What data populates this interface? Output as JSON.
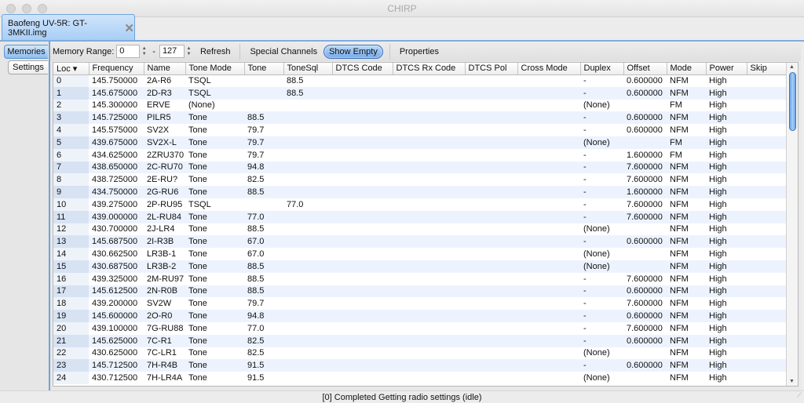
{
  "window": {
    "title": "CHIRP"
  },
  "doc_tab": {
    "label": "Baofeng UV-5R: GT-3MKII.img",
    "close_icon": "close-x-icon"
  },
  "side_tabs": [
    {
      "label": "Memories",
      "active": true
    },
    {
      "label": "Settings",
      "active": false
    }
  ],
  "toolbar": {
    "memory_range_label": "Memory Range:",
    "range_start": "0",
    "range_dash": "-",
    "range_end": "127",
    "refresh": "Refresh",
    "special_channels": "Special Channels",
    "show_empty": "Show Empty",
    "properties": "Properties"
  },
  "table": {
    "columns": [
      "Loc ▾",
      "Frequency",
      "Name",
      "Tone Mode",
      "Tone",
      "ToneSql",
      "DTCS Code",
      "DTCS Rx Code",
      "DTCS Pol",
      "Cross Mode",
      "Duplex",
      "Offset",
      "Mode",
      "Power",
      "Skip"
    ],
    "rows": [
      [
        "0",
        "145.750000",
        "2A-R6",
        "TSQL",
        "",
        "88.5",
        "",
        "",
        "",
        "",
        "-",
        "0.600000",
        "NFM",
        "High",
        ""
      ],
      [
        "1",
        "145.675000",
        "2D-R3",
        "TSQL",
        "",
        "88.5",
        "",
        "",
        "",
        "",
        "-",
        "0.600000",
        "NFM",
        "High",
        ""
      ],
      [
        "2",
        "145.300000",
        "ERVE",
        "(None)",
        "",
        "",
        "",
        "",
        "",
        "",
        "(None)",
        "",
        "FM",
        "High",
        ""
      ],
      [
        "3",
        "145.725000",
        "PILR5",
        "Tone",
        "88.5",
        "",
        "",
        "",
        "",
        "",
        "-",
        "0.600000",
        "NFM",
        "High",
        ""
      ],
      [
        "4",
        "145.575000",
        "SV2X",
        "Tone",
        "79.7",
        "",
        "",
        "",
        "",
        "",
        "-",
        "0.600000",
        "NFM",
        "High",
        ""
      ],
      [
        "5",
        "439.675000",
        "SV2X-L",
        "Tone",
        "79.7",
        "",
        "",
        "",
        "",
        "",
        "(None)",
        "",
        "FM",
        "High",
        ""
      ],
      [
        "6",
        "434.625000",
        "2ZRU370",
        "Tone",
        "79.7",
        "",
        "",
        "",
        "",
        "",
        "-",
        "1.600000",
        "FM",
        "High",
        ""
      ],
      [
        "7",
        "438.650000",
        "2C-RU70",
        "Tone",
        "94.8",
        "",
        "",
        "",
        "",
        "",
        "-",
        "7.600000",
        "NFM",
        "High",
        ""
      ],
      [
        "8",
        "438.725000",
        "2E-RU?",
        "Tone",
        "82.5",
        "",
        "",
        "",
        "",
        "",
        "-",
        "7.600000",
        "NFM",
        "High",
        ""
      ],
      [
        "9",
        "434.750000",
        "2G-RU6",
        "Tone",
        "88.5",
        "",
        "",
        "",
        "",
        "",
        "-",
        "1.600000",
        "NFM",
        "High",
        ""
      ],
      [
        "10",
        "439.275000",
        "2P-RU95",
        "TSQL",
        "",
        "77.0",
        "",
        "",
        "",
        "",
        "-",
        "7.600000",
        "NFM",
        "High",
        ""
      ],
      [
        "11",
        "439.000000",
        "2L-RU84",
        "Tone",
        "77.0",
        "",
        "",
        "",
        "",
        "",
        "-",
        "7.600000",
        "NFM",
        "High",
        ""
      ],
      [
        "12",
        "430.700000",
        "2J-LR4",
        "Tone",
        "88.5",
        "",
        "",
        "",
        "",
        "",
        "(None)",
        "",
        "NFM",
        "High",
        ""
      ],
      [
        "13",
        "145.687500",
        "2I-R3B",
        "Tone",
        "67.0",
        "",
        "",
        "",
        "",
        "",
        "-",
        "0.600000",
        "NFM",
        "High",
        ""
      ],
      [
        "14",
        "430.662500",
        "LR3B-1",
        "Tone",
        "67.0",
        "",
        "",
        "",
        "",
        "",
        "(None)",
        "",
        "NFM",
        "High",
        ""
      ],
      [
        "15",
        "430.687500",
        "LR3B-2",
        "Tone",
        "88.5",
        "",
        "",
        "",
        "",
        "",
        "(None)",
        "",
        "NFM",
        "High",
        ""
      ],
      [
        "16",
        "439.325000",
        "2M-RU97",
        "Tone",
        "88.5",
        "",
        "",
        "",
        "",
        "",
        "-",
        "7.600000",
        "NFM",
        "High",
        ""
      ],
      [
        "17",
        "145.612500",
        "2N-R0B",
        "Tone",
        "88.5",
        "",
        "",
        "",
        "",
        "",
        "-",
        "0.600000",
        "NFM",
        "High",
        ""
      ],
      [
        "18",
        "439.200000",
        "SV2W",
        "Tone",
        "79.7",
        "",
        "",
        "",
        "",
        "",
        "-",
        "7.600000",
        "NFM",
        "High",
        ""
      ],
      [
        "19",
        "145.600000",
        "2O-R0",
        "Tone",
        "94.8",
        "",
        "",
        "",
        "",
        "",
        "-",
        "0.600000",
        "NFM",
        "High",
        ""
      ],
      [
        "20",
        "439.100000",
        "7G-RU88",
        "Tone",
        "77.0",
        "",
        "",
        "",
        "",
        "",
        "-",
        "7.600000",
        "NFM",
        "High",
        ""
      ],
      [
        "21",
        "145.625000",
        "7C-R1",
        "Tone",
        "82.5",
        "",
        "",
        "",
        "",
        "",
        "-",
        "0.600000",
        "NFM",
        "High",
        ""
      ],
      [
        "22",
        "430.625000",
        "7C-LR1",
        "Tone",
        "82.5",
        "",
        "",
        "",
        "",
        "",
        "(None)",
        "",
        "NFM",
        "High",
        ""
      ],
      [
        "23",
        "145.712500",
        "7H-R4B",
        "Tone",
        "91.5",
        "",
        "",
        "",
        "",
        "",
        "-",
        "0.600000",
        "NFM",
        "High",
        ""
      ],
      [
        "24",
        "430.712500",
        "7H-LR4A",
        "Tone",
        "91.5",
        "",
        "",
        "",
        "",
        "",
        "(None)",
        "",
        "NFM",
        "High",
        ""
      ]
    ]
  },
  "status": {
    "text": "[0] Completed Getting radio settings (idle)"
  },
  "colors": {
    "accent": "#6fa3dd",
    "row_alt": "#edf3fe",
    "selected_tab": "#8dbdf0"
  }
}
